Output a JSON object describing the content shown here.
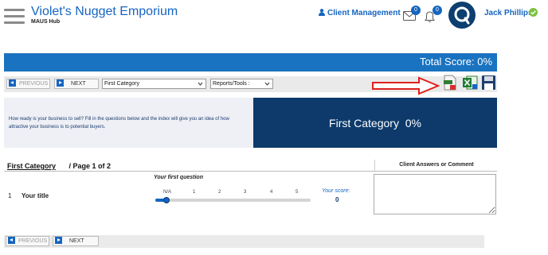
{
  "header": {
    "app_title": "Violet's Nugget Emporium",
    "app_subtitle": "MAUS Hub",
    "client_management": "Client Management",
    "mail_badge": "0",
    "notifications_badge": "0",
    "user_name": "Jack Phillips",
    "icons": [
      "hamburger-icon",
      "person-icon",
      "mail-icon",
      "bell-icon",
      "avatar",
      "check-circle-icon"
    ]
  },
  "total_score": "Total Score: 0%",
  "nav": {
    "previous": "PREVIOUS",
    "next": "NEXT",
    "category_select": "First Category",
    "reports_select": "Reports/Tools :",
    "toolbar_icons": [
      "red-arrow-icon",
      "pdf-export-icon",
      "excel-export-icon",
      "save-icon"
    ]
  },
  "intro": {
    "text": "How ready is your business to sell? Fill in the questions below and the index will give you an idea of how attractive your business is to potential buyers.",
    "category_score": "First Category  0%"
  },
  "questions": {
    "category_label": "First Category",
    "page_label": "/ Page 1 of 2",
    "answers_header": "Client Answers or Comment",
    "prompt": "Your first question",
    "items": [
      {
        "number": "1",
        "title": "Your title",
        "scale": [
          "N/A",
          "1",
          "2",
          "3",
          "4",
          "5"
        ],
        "score_label": "Your score:",
        "score_value": "0"
      }
    ]
  },
  "colors": {
    "brand_blue": "#1565c0",
    "score_bar": "#1a73c0",
    "dark_navy": "#0d3a6b"
  },
  "bottom_nav": {
    "previous": "PREVIOUS",
    "next": "NEXT"
  }
}
